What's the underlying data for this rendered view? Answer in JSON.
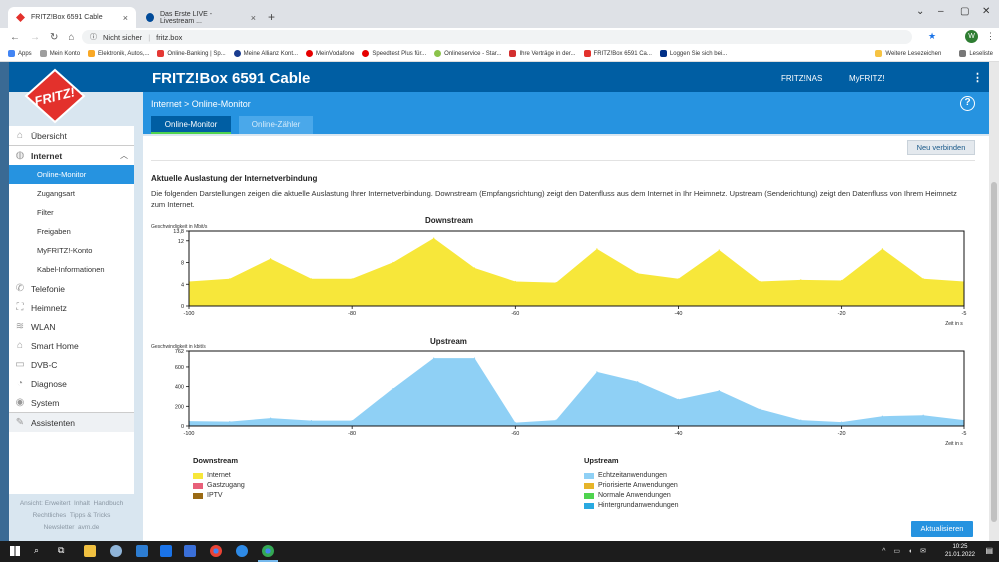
{
  "browser": {
    "tabs": [
      {
        "label": "FRITZ!Box 6591 Cable",
        "active": true
      },
      {
        "label": "Das Erste LIVE - Livestream ...",
        "active": false
      }
    ],
    "security": "Nicht sicher",
    "url": "fritz.box",
    "profile_initial": "W",
    "bookmarks": [
      "Apps",
      "Mein Konto",
      "Elektronik, Autos,...",
      "Online-Banking | Sp...",
      "Meine Allianz Kont...",
      "MeinVodafone",
      "Speedtest Plus für...",
      "Onlineservice - Star...",
      "Ihre Verträge in der...",
      "FRITZ!Box 6591 Ca...",
      "Loggen Sie sich bei..."
    ],
    "bookmarks_right": [
      "Weitere Lesezeichen",
      "Leseliste"
    ]
  },
  "header": {
    "logo_text": "FRITZ!",
    "title": "FRITZ!Box 6591 Cable",
    "links": [
      "FRITZ!NAS",
      "MyFRITZ!"
    ],
    "menu_icon": "⋮"
  },
  "subheader": {
    "breadcrumb": "Internet > Online-Monitor",
    "help": "?",
    "tabs": [
      "Online-Monitor",
      "Online-Zähler"
    ]
  },
  "sidebar": {
    "items": [
      {
        "label": "Übersicht",
        "icon": "home-icon",
        "glyph": "⌂"
      },
      {
        "label": "Internet",
        "icon": "globe-icon",
        "glyph": "◍"
      },
      {
        "label": "Online-Monitor",
        "sub": true,
        "selected": true
      },
      {
        "label": "Zugangsart",
        "sub": true
      },
      {
        "label": "Filter",
        "sub": true
      },
      {
        "label": "Freigaben",
        "sub": true
      },
      {
        "label": "MyFRITZ!-Konto",
        "sub": true
      },
      {
        "label": "Kabel-Informationen",
        "sub": true
      },
      {
        "label": "Telefonie",
        "icon": "phone-icon",
        "glyph": "✆"
      },
      {
        "label": "Heimnetz",
        "icon": "network-icon",
        "glyph": "⛶"
      },
      {
        "label": "WLAN",
        "icon": "wifi-icon",
        "glyph": "≋"
      },
      {
        "label": "Smart Home",
        "icon": "smarthome-icon",
        "glyph": "⌂"
      },
      {
        "label": "DVB-C",
        "icon": "tv-icon",
        "glyph": "▭"
      },
      {
        "label": "Diagnose",
        "icon": "diagnose-icon",
        "glyph": "◔"
      },
      {
        "label": "System",
        "icon": "system-icon",
        "glyph": "◉"
      },
      {
        "label": "Assistenten",
        "icon": "wizard-icon",
        "glyph": "✎"
      }
    ],
    "footer": [
      [
        "Ansicht: Erweitert",
        "Inhalt",
        "Handbuch"
      ],
      [
        "Rechtliches",
        "Tipps & Tricks"
      ],
      [
        "Newsletter",
        "avm.de"
      ]
    ]
  },
  "main": {
    "reconnect_button": "Neu verbinden",
    "section_title": "Aktuelle Auslastung der Internetverbindung",
    "description": "Die folgenden Darstellungen zeigen die aktuelle Auslastung Ihrer Internetverbindung. Downstream (Empfangsrichtung) zeigt den Datenfluss aus dem Internet in Ihr Heimnetz. Upstream (Senderichtung) zeigt den Datenfluss von Ihrem Heimnetz zum Internet.",
    "update_button": "Aktualisieren"
  },
  "chart_data": [
    {
      "type": "area",
      "title": "Downstream",
      "ylabel": "Geschwindigkeit in Mbit/s",
      "xlabel": "Zeit in s",
      "xlim": [
        -100,
        -5
      ],
      "ylim": [
        0,
        13.8
      ],
      "yticks": [
        "13,8",
        "12",
        "8",
        "4",
        "0"
      ],
      "ytick_values": [
        13.8,
        12,
        8,
        4,
        0
      ],
      "xticks": [
        "-100",
        "-80",
        "-60",
        "-40",
        "-20",
        "-5"
      ],
      "xtick_values": [
        -100,
        -80,
        -60,
        -40,
        -20,
        -5
      ],
      "grid": false,
      "color": "#f7e73a",
      "series": [
        {
          "x": [
            -100,
            -95,
            -90,
            -85,
            -80,
            -75,
            -70,
            -65,
            -60,
            -55,
            -50,
            -45,
            -40,
            -35,
            -30,
            -25,
            -20,
            -15,
            -10,
            -5
          ],
          "values": [
            4.5,
            5.0,
            8.7,
            5.0,
            5.0,
            8.0,
            12.5,
            7.0,
            4.5,
            4.3,
            10.5,
            6.0,
            5.0,
            10.3,
            4.5,
            4.8,
            4.7,
            10.5,
            5.0,
            4.5
          ]
        }
      ]
    },
    {
      "type": "area",
      "title": "Upstream",
      "ylabel": "Geschwindigkeit in kbit/s",
      "xlabel": "Zeit in s",
      "xlim": [
        -100,
        -5
      ],
      "ylim": [
        0,
        762
      ],
      "yticks": [
        "762",
        "600",
        "400",
        "200",
        "0"
      ],
      "ytick_values": [
        762,
        600,
        400,
        200,
        0
      ],
      "xticks": [
        "-100",
        "-80",
        "-60",
        "-40",
        "-20",
        "-5"
      ],
      "xtick_values": [
        -100,
        -80,
        -60,
        -40,
        -20,
        -5
      ],
      "grid": false,
      "color": "#8fd0f5",
      "series": [
        {
          "x": [
            -100,
            -95,
            -90,
            -85,
            -80,
            -75,
            -70,
            -65,
            -60,
            -55,
            -50,
            -45,
            -40,
            -35,
            -30,
            -25,
            -20,
            -15,
            -10,
            -5
          ],
          "values": [
            50,
            45,
            80,
            55,
            55,
            380,
            690,
            690,
            35,
            60,
            550,
            450,
            270,
            360,
            170,
            60,
            40,
            100,
            110,
            60
          ]
        }
      ]
    }
  ],
  "legend": {
    "downstream": {
      "title": "Downstream",
      "items": [
        {
          "label": "Internet",
          "color": "#f7e73a"
        },
        {
          "label": "Gastzugang",
          "color": "#e8607a"
        },
        {
          "label": "IPTV",
          "color": "#9a6a14"
        }
      ]
    },
    "upstream": {
      "title": "Upstream",
      "items": [
        {
          "label": "Echtzeitanwendungen",
          "color": "#8fd0f5"
        },
        {
          "label": "Priorisierte Anwendungen",
          "color": "#e6b42a"
        },
        {
          "label": "Normale Anwendungen",
          "color": "#4fd34f"
        },
        {
          "label": "Hintergrundanwendungen",
          "color": "#2aa9e0"
        }
      ]
    }
  },
  "taskbar": {
    "time": "10:25",
    "date": "21.01.2022"
  }
}
